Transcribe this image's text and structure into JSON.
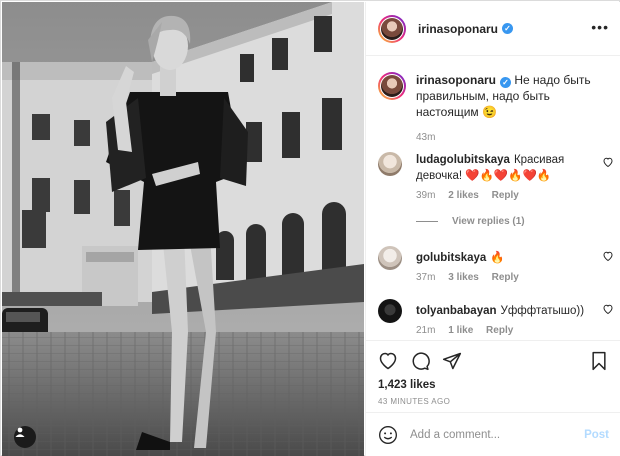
{
  "post": {
    "username": "irinasoponaru",
    "verified": true,
    "more_icon": "more-horizontal-icon",
    "tag_icon": "user-tag-icon"
  },
  "caption": {
    "username": "irinasoponaru",
    "text": "Не надо быть правильным, надо быть настоящим 😉",
    "time": "43m"
  },
  "comments": [
    {
      "username": "ludagolubitskaya",
      "text": "Красивая девочка! ❤️🔥❤️🔥❤️🔥",
      "time": "39m",
      "likes": "2 likes",
      "reply": "Reply",
      "avatar_color": "#e9e1d8"
    },
    {
      "username": "golubitskaya",
      "text": "🔥",
      "time": "37m",
      "likes": "3 likes",
      "reply": "Reply",
      "avatar_color": "#d9d2cc"
    },
    {
      "username": "tolyanbabayan",
      "text": "Уфффтатышо))",
      "time": "21m",
      "likes": "1 like",
      "reply": "Reply",
      "avatar_color": "#1c1c1c"
    }
  ],
  "view_replies": "View replies (1)",
  "actions": {
    "likes": "1,423 likes",
    "posted_ago": "43 MINUTES AGO"
  },
  "add_comment": {
    "placeholder": "Add a comment...",
    "post_label": "Post"
  },
  "colors": {
    "accent": "#3897f0",
    "post_disabled": "#b3dbff",
    "muted": "#8e8e8e"
  }
}
